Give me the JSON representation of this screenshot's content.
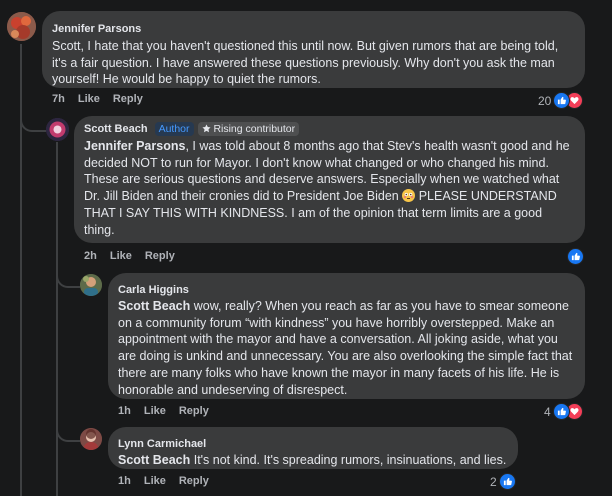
{
  "comments": [
    {
      "author": "Jennifer Parsons",
      "text": "Scott, I hate that you haven't questioned this until now. But given rumors that are being told, it's a fair question. I have answered these questions previously. Why don't you ask the man yourself! He would be happy to quiet the rumors.",
      "time": "7h",
      "like": "Like",
      "reply": "Reply",
      "reaction_count": "20",
      "reactions": [
        "like",
        "love"
      ]
    },
    {
      "author": "Scott Beach",
      "badge_author": "Author",
      "badge_rising": "Rising contributor",
      "mention": "Jennifer Parsons",
      "text_before_emoji": ", I was told about 8 months ago that Stev's health wasn't good and he decided NOT to run for Mayor. I don't know what changed or who changed his mind. These are serious questions and deserve answers. Especially when we watched what Dr. Jill Biden and their cronies did to President Joe Biden",
      "emoji": "flushed-face",
      "text_after_emoji": " PLEASE UNDERSTAND THAT I SAY THIS WITH KINDNESS. I am of the opinion that term limits are a good thing.",
      "time": "2h",
      "like": "Like",
      "reply": "Reply",
      "reaction_count": "",
      "reactions": [
        "like"
      ]
    },
    {
      "author": "Carla Higgins",
      "mention": "Scott Beach",
      "text": " wow, really? When you reach as far as you have to smear someone on a community forum “with kindness” you have horribly overstepped. Make an appointment with the mayor and have a conversation. All joking aside, what you are doing is unkind and unnecessary. You are also overlooking the simple fact that there are many folks who have known the mayor in many facets of his life. He is honorable and undeserving of disrespect.",
      "time": "1h",
      "like": "Like",
      "reply": "Reply",
      "reaction_count": "4",
      "reactions": [
        "like",
        "love"
      ]
    },
    {
      "author": "Lynn Carmichael",
      "mention": "Scott Beach",
      "text": " It's not kind. It's spreading rumors, insinuations, and lies.",
      "time": "1h",
      "like": "Like",
      "reply": "Reply",
      "reaction_count": "2",
      "reactions": [
        "like"
      ]
    }
  ],
  "colors": {
    "background": "#18191a",
    "bubble": "#3a3b3c",
    "like": "#1877f2",
    "love": "#f33e58",
    "author_badge": "#4599ff"
  }
}
